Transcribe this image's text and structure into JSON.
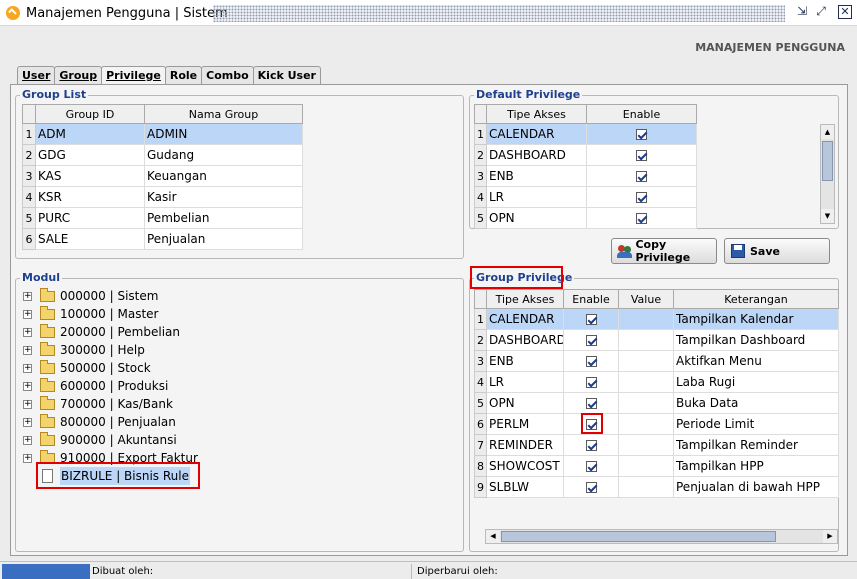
{
  "window": {
    "title": "Manajemen Pengguna | Sistem"
  },
  "header": {
    "title": "MANAJEMEN PENGGUNA"
  },
  "tabs": [
    {
      "label": "User"
    },
    {
      "label": "Group"
    },
    {
      "label": "Privilege"
    },
    {
      "label": "Role"
    },
    {
      "label": "Combo"
    },
    {
      "label": "Kick User"
    }
  ],
  "active_tab": "Privilege",
  "group_list": {
    "title": "Group List",
    "columns": [
      "Group ID",
      "Nama Group"
    ],
    "rows": [
      {
        "num": "1",
        "id": "ADM",
        "name": "ADMIN"
      },
      {
        "num": "2",
        "id": "GDG",
        "name": "Gudang"
      },
      {
        "num": "3",
        "id": "KAS",
        "name": "Keuangan"
      },
      {
        "num": "4",
        "id": "KSR",
        "name": "Kasir"
      },
      {
        "num": "5",
        "id": "PURC",
        "name": "Pembelian"
      },
      {
        "num": "6",
        "id": "SALE",
        "name": "Penjualan"
      }
    ]
  },
  "default_privilege": {
    "title": "Default Privilege",
    "columns": [
      "Tipe Akses",
      "Enable"
    ],
    "rows": [
      {
        "num": "1",
        "tipe": "CALENDAR",
        "enable": true
      },
      {
        "num": "2",
        "tipe": "DASHBOARD",
        "enable": true
      },
      {
        "num": "3",
        "tipe": "ENB",
        "enable": true
      },
      {
        "num": "4",
        "tipe": "LR",
        "enable": true
      },
      {
        "num": "5",
        "tipe": "OPN",
        "enable": true
      }
    ]
  },
  "buttons": {
    "copy_privilege": "Copy Privilege",
    "save": "Save"
  },
  "modul": {
    "title": "Modul",
    "items": [
      {
        "label": "000000 | Sistem"
      },
      {
        "label": "100000 | Master"
      },
      {
        "label": "200000 | Pembelian"
      },
      {
        "label": "300000 | Help"
      },
      {
        "label": "500000 | Stock"
      },
      {
        "label": "600000 | Produksi"
      },
      {
        "label": "700000 | Kas/Bank"
      },
      {
        "label": "800000 | Penjualan"
      },
      {
        "label": "900000 | Akuntansi"
      },
      {
        "label": "910000 | Export Faktur"
      }
    ],
    "selected_item": "BIZRULE | Bisnis Rule"
  },
  "group_privilege": {
    "title": "Group Privilege",
    "columns": [
      "Tipe Akses",
      "Enable",
      "Value",
      "Keterangan"
    ],
    "rows": [
      {
        "num": "1",
        "tipe": "CALENDAR",
        "enable": true,
        "value": "",
        "keterangan": "Tampilkan Kalendar"
      },
      {
        "num": "2",
        "tipe": "DASHBOARD",
        "enable": true,
        "value": "",
        "keterangan": "Tampilkan Dashboard"
      },
      {
        "num": "3",
        "tipe": "ENB",
        "enable": true,
        "value": "",
        "keterangan": "Aktifkan Menu"
      },
      {
        "num": "4",
        "tipe": "LR",
        "enable": true,
        "value": "",
        "keterangan": "Laba Rugi"
      },
      {
        "num": "5",
        "tipe": "OPN",
        "enable": true,
        "value": "",
        "keterangan": "Buka Data"
      },
      {
        "num": "6",
        "tipe": "PERLM",
        "enable": true,
        "value": "",
        "keterangan": "Periode Limit"
      },
      {
        "num": "7",
        "tipe": "REMINDER",
        "enable": true,
        "value": "",
        "keterangan": "Tampilkan Reminder"
      },
      {
        "num": "8",
        "tipe": "SHOWCOST",
        "enable": true,
        "value": "",
        "keterangan": "Tampilkan HPP"
      },
      {
        "num": "9",
        "tipe": "SLBLW",
        "enable": true,
        "value": "",
        "keterangan": "Penjualan di bawah HPP"
      }
    ]
  },
  "status": {
    "dibuat": "Dibuat oleh:",
    "diperbarui": "Diperbarui oleh:"
  },
  "colors": {
    "selection": "#bcd6f7",
    "group_title": "#1f3f8f",
    "highlight": "#e00000",
    "status_block": "#3a6ec0"
  }
}
